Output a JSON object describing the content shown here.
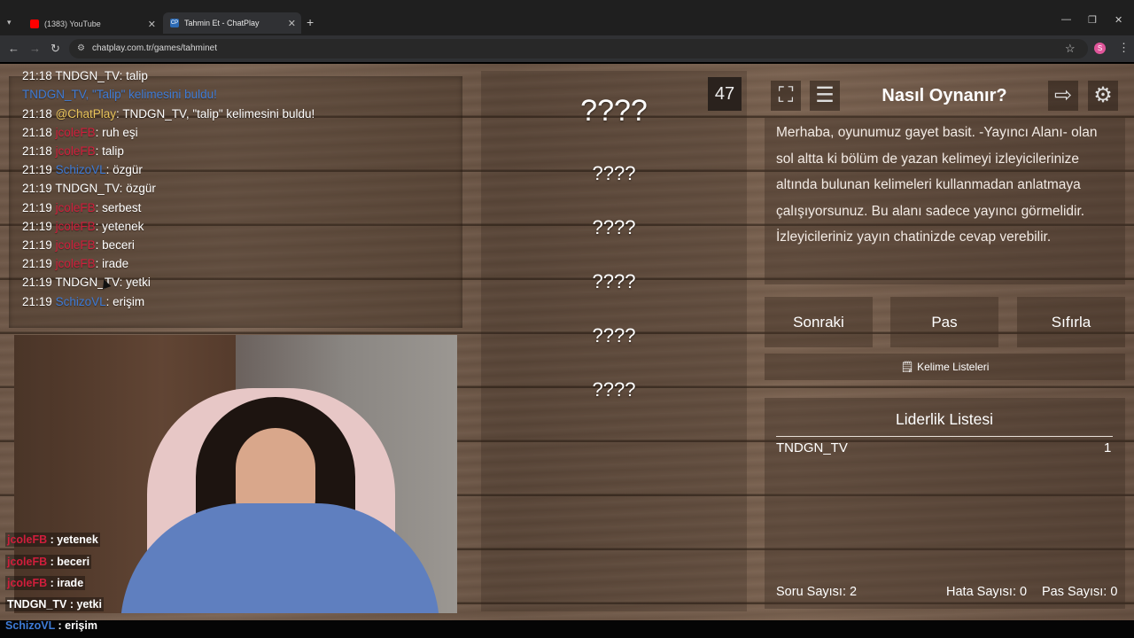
{
  "browser": {
    "tabs": [
      {
        "label": "(1383) YouTube",
        "active": false,
        "favicon_color": "#ff0000"
      },
      {
        "label": "Tahmin Et - ChatPlay",
        "active": true,
        "favicon_label": "CP"
      }
    ],
    "url": "chatplay.com.tr/games/tahminet",
    "profile_initial": "S"
  },
  "chat": {
    "lines": [
      {
        "time": "21:18",
        "user": "TNDGN_TV",
        "user_color": "white",
        "sep": ": ",
        "text": "talip"
      },
      {
        "time": "",
        "user": "TNDGN_TV, \"Talip\" kelimesini buldu!",
        "user_color": "blue",
        "sep": "",
        "text": ""
      },
      {
        "time": "21:18",
        "user": "@ChatPlay",
        "user_color": "gold",
        "sep": ": ",
        "text": "TNDGN_TV, \"talip\" kelimesini buldu!"
      },
      {
        "time": "21:18",
        "user": "jcoleFB",
        "user_color": "red",
        "sep": ": ",
        "text": "ruh eşi"
      },
      {
        "time": "21:18",
        "user": "jcoleFB",
        "user_color": "red",
        "sep": ": ",
        "text": "talip"
      },
      {
        "time": "21:19",
        "user": "SchizoVL",
        "user_color": "blue",
        "sep": ": ",
        "text": "özgür"
      },
      {
        "time": "21:19",
        "user": "TNDGN_TV",
        "user_color": "white",
        "sep": ": ",
        "text": "özgür"
      },
      {
        "time": "21:19",
        "user": "jcoleFB",
        "user_color": "red",
        "sep": ": ",
        "text": "serbest"
      },
      {
        "time": "21:19",
        "user": "jcoleFB",
        "user_color": "red",
        "sep": ": ",
        "text": "yetenek"
      },
      {
        "time": "21:19",
        "user": "jcoleFB",
        "user_color": "red",
        "sep": ": ",
        "text": "beceri"
      },
      {
        "time": "21:19",
        "user": "jcoleFB",
        "user_color": "red",
        "sep": ": ",
        "text": "irade"
      },
      {
        "time": "21:19",
        "user": "TNDGN_TV",
        "user_color": "white",
        "sep": ": ",
        "text": "yetki"
      },
      {
        "time": "21:19",
        "user": "SchizoVL",
        "user_color": "blue",
        "sep": ": ",
        "text": "erişim"
      }
    ]
  },
  "stream_overlay": {
    "lines": [
      {
        "user": "jcoleFB",
        "user_color": "red",
        "text": "yetenek"
      },
      {
        "user": "jcoleFB",
        "user_color": "red",
        "text": "beceri"
      },
      {
        "user": "jcoleFB",
        "user_color": "red",
        "text": "irade"
      },
      {
        "user": "TNDGN_TV",
        "user_color": "white",
        "text": "yetki"
      },
      {
        "user": "SchizoVL",
        "user_color": "blue",
        "text": "erişim"
      }
    ]
  },
  "game": {
    "timer": "47",
    "main_word": "????",
    "forbidden_words": [
      "????",
      "????",
      "????",
      "????",
      "????"
    ]
  },
  "sidebar": {
    "fullscreen_icon": "fullscreen-icon",
    "notes_icon": "list-icon",
    "howto_title": "Nasıl Oynanır?",
    "exit_icon": "exit-icon",
    "settings_icon": "gear-icon",
    "description": "Merhaba, oyunumuz gayet basit. -Yayıncı Alanı- olan sol altta ki bölüm de yazan kelimeyi izleyicilerinize altında bulunan kelimeleri kullanmadan anlatmaya çalışıyorsunuz. Bu alanı sadece yayıncı görmelidir. İzleyicileriniz yayın chatinizde cevap verebilir.",
    "buttons": {
      "next": "Sonraki",
      "pass": "Pas",
      "reset": "Sıfırla"
    },
    "word_lists": "Kelime Listeleri",
    "leaderboard": {
      "title": "Liderlik Listesi",
      "rows": [
        {
          "name": "TNDGN_TV",
          "score": "1"
        }
      ]
    },
    "stats": {
      "questions_label": "Soru Sayısı:",
      "questions": "2",
      "errors_label": "Hata Sayısı:",
      "errors": "0",
      "passes_label": "Pas Sayısı:",
      "passes": "0"
    }
  },
  "colors": {
    "red": "#d01e3c",
    "blue": "#3e7bd6",
    "gold": "#e8c35a",
    "white": "#ffffff"
  }
}
